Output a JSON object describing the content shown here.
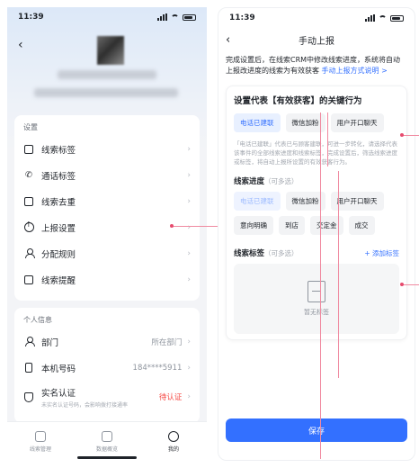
{
  "left": {
    "status_time": "11:39",
    "settings_title": "设置",
    "settings_items": [
      {
        "label": "线索标签",
        "icon": "tag-doc-icon"
      },
      {
        "label": "通话标签",
        "icon": "phone-call-icon"
      },
      {
        "label": "线索去重",
        "icon": "dedupe-icon"
      },
      {
        "label": "上报设置",
        "icon": "upload-icon"
      },
      {
        "label": "分配规则",
        "icon": "assign-user-icon"
      },
      {
        "label": "线索提醒",
        "icon": "reminder-icon"
      }
    ],
    "personal_title": "个人信息",
    "department_label": "部门",
    "department_value": "所在部门",
    "phone_label": "本机号码",
    "phone_value": "184****5911",
    "realname_label": "实名认证",
    "realname_sub": "未实名认证号码，会影响拨打接通率",
    "realname_value": "待认证",
    "tabs": [
      {
        "label": "线索管理",
        "active": false
      },
      {
        "label": "数据概览",
        "active": false
      },
      {
        "label": "我的",
        "active": true
      }
    ]
  },
  "right": {
    "status_time": "11:39",
    "nav_title": "手动上报",
    "notice_text": "完成设置后，在线索CRM中修改线索进度，系统将自动上报改进度的线索为有效获客",
    "notice_link": "手动上报方式说明 >",
    "panel_title": "设置代表【有效获客】的关键行为",
    "key_actions": [
      {
        "label": "电话已建联",
        "selected": true
      },
      {
        "label": "微信加粉",
        "selected": false
      },
      {
        "label": "用户开口聊天",
        "selected": false
      }
    ],
    "hint": "「电话已建联」代表已与顾客建联，可进一步转化，请选择代表该事件的全部线索进度和线索标签，完成设置后，筛选线索进度或标签，将自动上报所设置的有效获客行为。",
    "progress_title": "线索进度",
    "multi_hint": "（可多选）",
    "progress_options": [
      {
        "label": "电话已建联",
        "state": "disabled"
      },
      {
        "label": "微信加粉",
        "state": "normal"
      },
      {
        "label": "用户开口聊天",
        "state": "normal"
      },
      {
        "label": "意向明确",
        "state": "normal"
      },
      {
        "label": "到店",
        "state": "normal"
      },
      {
        "label": "交定金",
        "state": "normal"
      },
      {
        "label": "成交",
        "state": "normal"
      }
    ],
    "tag_title": "线索标签",
    "tag_multi_hint": "（可多选）",
    "add_tag": "+ 添加标签",
    "empty_text": "暂无标签",
    "save_label": "保存"
  },
  "colors": {
    "accent": "#3370ff",
    "annotation": "#f08aa0",
    "warning": "#f54a45"
  }
}
